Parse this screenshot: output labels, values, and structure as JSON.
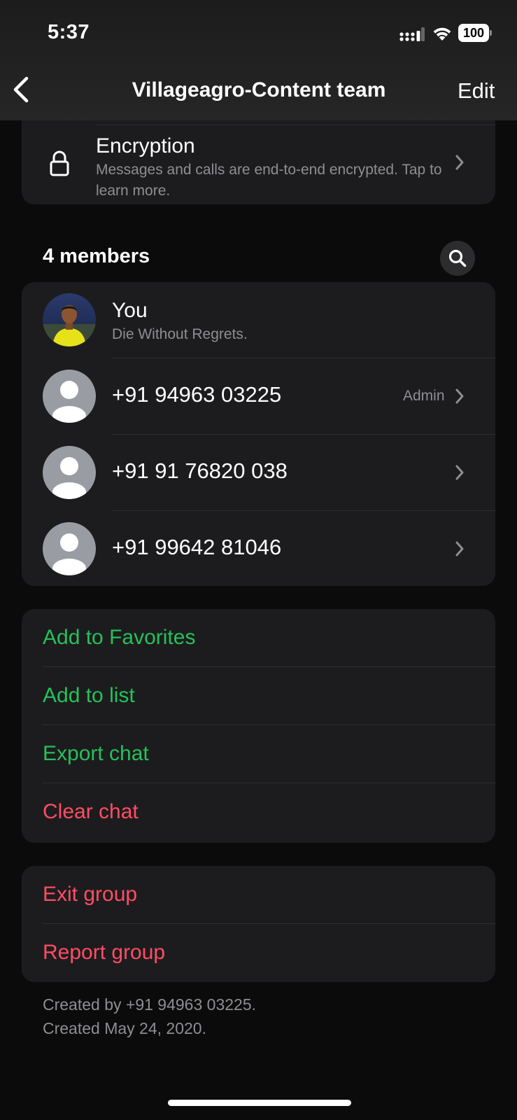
{
  "status_bar": {
    "time": "5:37",
    "battery": "100"
  },
  "nav": {
    "title": "Villageagro-Content team",
    "edit_label": "Edit"
  },
  "encryption": {
    "title": "Encryption",
    "subtitle": "Messages and calls are end-to-end encrypted. Tap to learn more."
  },
  "members": {
    "header": "4 members",
    "items": [
      {
        "name": "You",
        "status": "Die Without Regrets.",
        "badge": ""
      },
      {
        "name": "+91 94963 03225",
        "status": "",
        "badge": "Admin"
      },
      {
        "name": "+91 91 76820 038",
        "status": "",
        "badge": ""
      },
      {
        "name": "+91 99642 81046",
        "status": "",
        "badge": ""
      }
    ]
  },
  "actions": {
    "add_favorites": "Add to Favorites",
    "add_list": "Add to list",
    "export_chat": "Export chat",
    "clear_chat": "Clear chat"
  },
  "group_actions": {
    "exit_group": "Exit group",
    "report_group": "Report group"
  },
  "footer": {
    "created_by": "Created by +91 94963 03225.",
    "created_date": "Created May 24, 2020."
  },
  "colors": {
    "accent_green": "#25c15a",
    "destructive_red": "#ff4d63",
    "card_bg": "#1c1c1e",
    "secondary_text": "#8e8e93"
  }
}
